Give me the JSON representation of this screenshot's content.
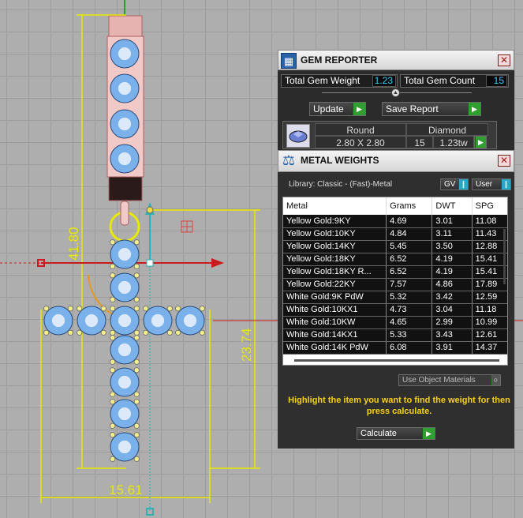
{
  "viewport": {
    "dimensions": {
      "height": "41.80",
      "vertical_right": "23.74",
      "horizontal": "15.61"
    },
    "colors": {
      "dimension": "#e8e800",
      "gem": "#7ab1ea",
      "metal": "#e4aaa8",
      "axis_x": "#d02020",
      "axis_y": "#2bb4b4"
    }
  },
  "gem_reporter": {
    "title": "GEM REPORTER",
    "total_gem_weight_label": "Total Gem Weight",
    "total_gem_weight_value": "1.23",
    "total_gem_count_label": "Total Gem Count",
    "total_gem_count_value": "15",
    "update_label": "Update",
    "save_report_label": "Save Report",
    "gem_row": {
      "cut": "Round",
      "material": "Diamond",
      "size": "2.80 X 2.80",
      "count": "15",
      "weight": "1.23tw"
    }
  },
  "metal_weights": {
    "title": "METAL WEIGHTS",
    "library": "Library: Classic - (Fast)-Metal",
    "gv_label": "GV",
    "user_label": "User",
    "columns": [
      "Metal",
      "Grams",
      "DWT",
      "SPG"
    ],
    "rows": [
      [
        "Yellow Gold:9KY",
        "4.69",
        "3.01",
        "11.08"
      ],
      [
        "Yellow Gold:10KY",
        "4.84",
        "3.11",
        "11.43"
      ],
      [
        "Yellow Gold:14KY",
        "5.45",
        "3.50",
        "12.88"
      ],
      [
        "Yellow Gold:18KY",
        "6.52",
        "4.19",
        "15.41"
      ],
      [
        "Yellow Gold:18KY R...",
        "6.52",
        "4.19",
        "15.41"
      ],
      [
        "Yellow Gold:22KY",
        "7.57",
        "4.86",
        "17.89"
      ],
      [
        "White Gold:9K PdW",
        "5.32",
        "3.42",
        "12.59"
      ],
      [
        "White Gold:10KX1",
        "4.73",
        "3.04",
        "11.18"
      ],
      [
        "White Gold:10KW",
        "4.65",
        "2.99",
        "10.99"
      ],
      [
        "White Gold:14KX1",
        "5.33",
        "3.43",
        "12.61"
      ],
      [
        "White Gold:14K PdW",
        "6.08",
        "3.91",
        "14.37"
      ]
    ],
    "use_object_materials_label": "Use Object Materials",
    "hint": "Highlight the item you want to find the weight for then press calculate.",
    "calculate_label": "Calculate"
  }
}
